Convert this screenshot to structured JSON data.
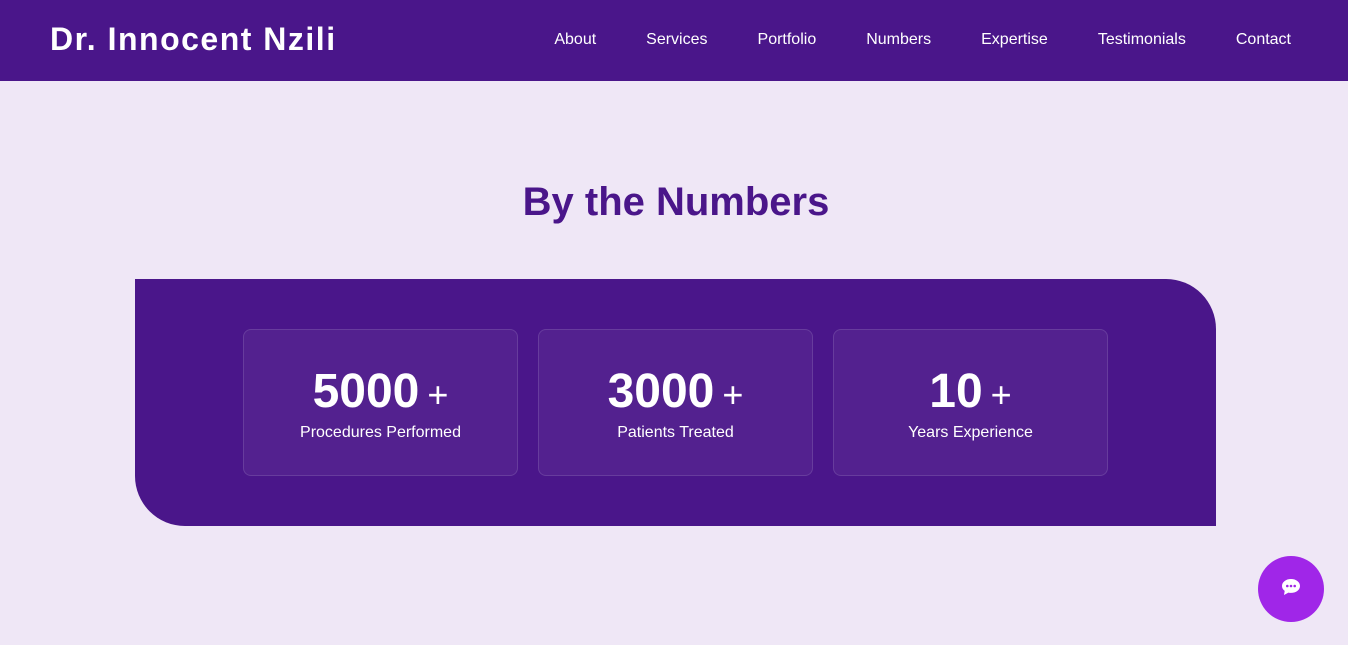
{
  "header": {
    "brand": "Dr. Innocent Nzili",
    "nav": [
      {
        "label": "About"
      },
      {
        "label": "Services"
      },
      {
        "label": "Portfolio"
      },
      {
        "label": "Numbers"
      },
      {
        "label": "Expertise"
      },
      {
        "label": "Testimonials"
      },
      {
        "label": "Contact"
      }
    ]
  },
  "numbers": {
    "title": "By the Numbers",
    "stats": [
      {
        "value": "5000",
        "suffix": "+",
        "label": "Procedures Performed"
      },
      {
        "value": "3000",
        "suffix": "+",
        "label": "Patients Treated"
      },
      {
        "value": "10",
        "suffix": "+",
        "label": "Years Experience"
      }
    ]
  },
  "chat": {
    "icon": "chat-bubble-icon"
  },
  "colors": {
    "primary": "#4a168a",
    "background": "#efe7f6",
    "accent": "#a026e8"
  }
}
